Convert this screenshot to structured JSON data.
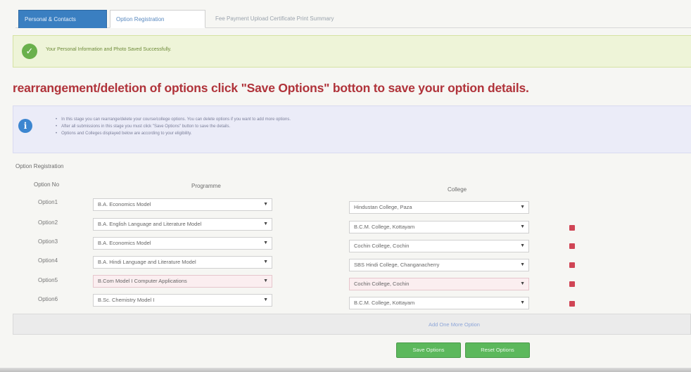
{
  "tabs": [
    {
      "label": "Personal & Contacts"
    },
    {
      "label": "Option Registration"
    },
    {
      "label": "Fee Payment Upload Certificate   Print Summary"
    }
  ],
  "alert": {
    "text": "Your Personal Information and Photo Saved Successfully."
  },
  "heading": "rearrangement/deletion of options click \"Save Options\" botton to save your option details.",
  "info": {
    "items": [
      "In this stage you can rearrange/delete your course/college options. You can delete options if you want to add more options.",
      "After all submissions in this stage you must click \"Save Options\" button to save the details.",
      "Options and Colleges displayed below are according to your eligibility."
    ]
  },
  "section_label": "Option Registration",
  "columns": {
    "option_no": "Option No",
    "programme": "Programme",
    "college": "College"
  },
  "options": [
    {
      "label": "Option1",
      "programme": "B.A. Economics Model",
      "college": "Hindustan College, Paza",
      "highlight": false,
      "deletable": false
    },
    {
      "label": "Option2",
      "programme": "B.A. English Language and Literature Model",
      "college": "B.C.M. College, Kottayam",
      "highlight": false,
      "deletable": true
    },
    {
      "label": "Option3",
      "programme": "B.A. Economics Model",
      "college": "Cochin College, Cochin",
      "highlight": false,
      "deletable": true
    },
    {
      "label": "Option4",
      "programme": "B.A. Hindi Language and Literature Model",
      "college": "SBS Hindi College, Changanacherry",
      "highlight": false,
      "deletable": true
    },
    {
      "label": "Option5",
      "programme": "B.Com Model I Computer Applications",
      "college": "Cochin College, Cochin",
      "highlight": true,
      "deletable": true
    },
    {
      "label": "Option6",
      "programme": "B.Sc. Chemistry Model I",
      "college": "B.C.M. College, Kottayam",
      "highlight": false,
      "deletable": true
    }
  ],
  "add_link": "Add One More Option",
  "buttons": {
    "save": "Save Options",
    "reset": "Reset Options"
  },
  "colors": {
    "accent": "#3a7fc1",
    "heading": "#b0333a",
    "success": "#5cb85c",
    "delete": "#d04555",
    "highlight": "#fbeef0"
  }
}
